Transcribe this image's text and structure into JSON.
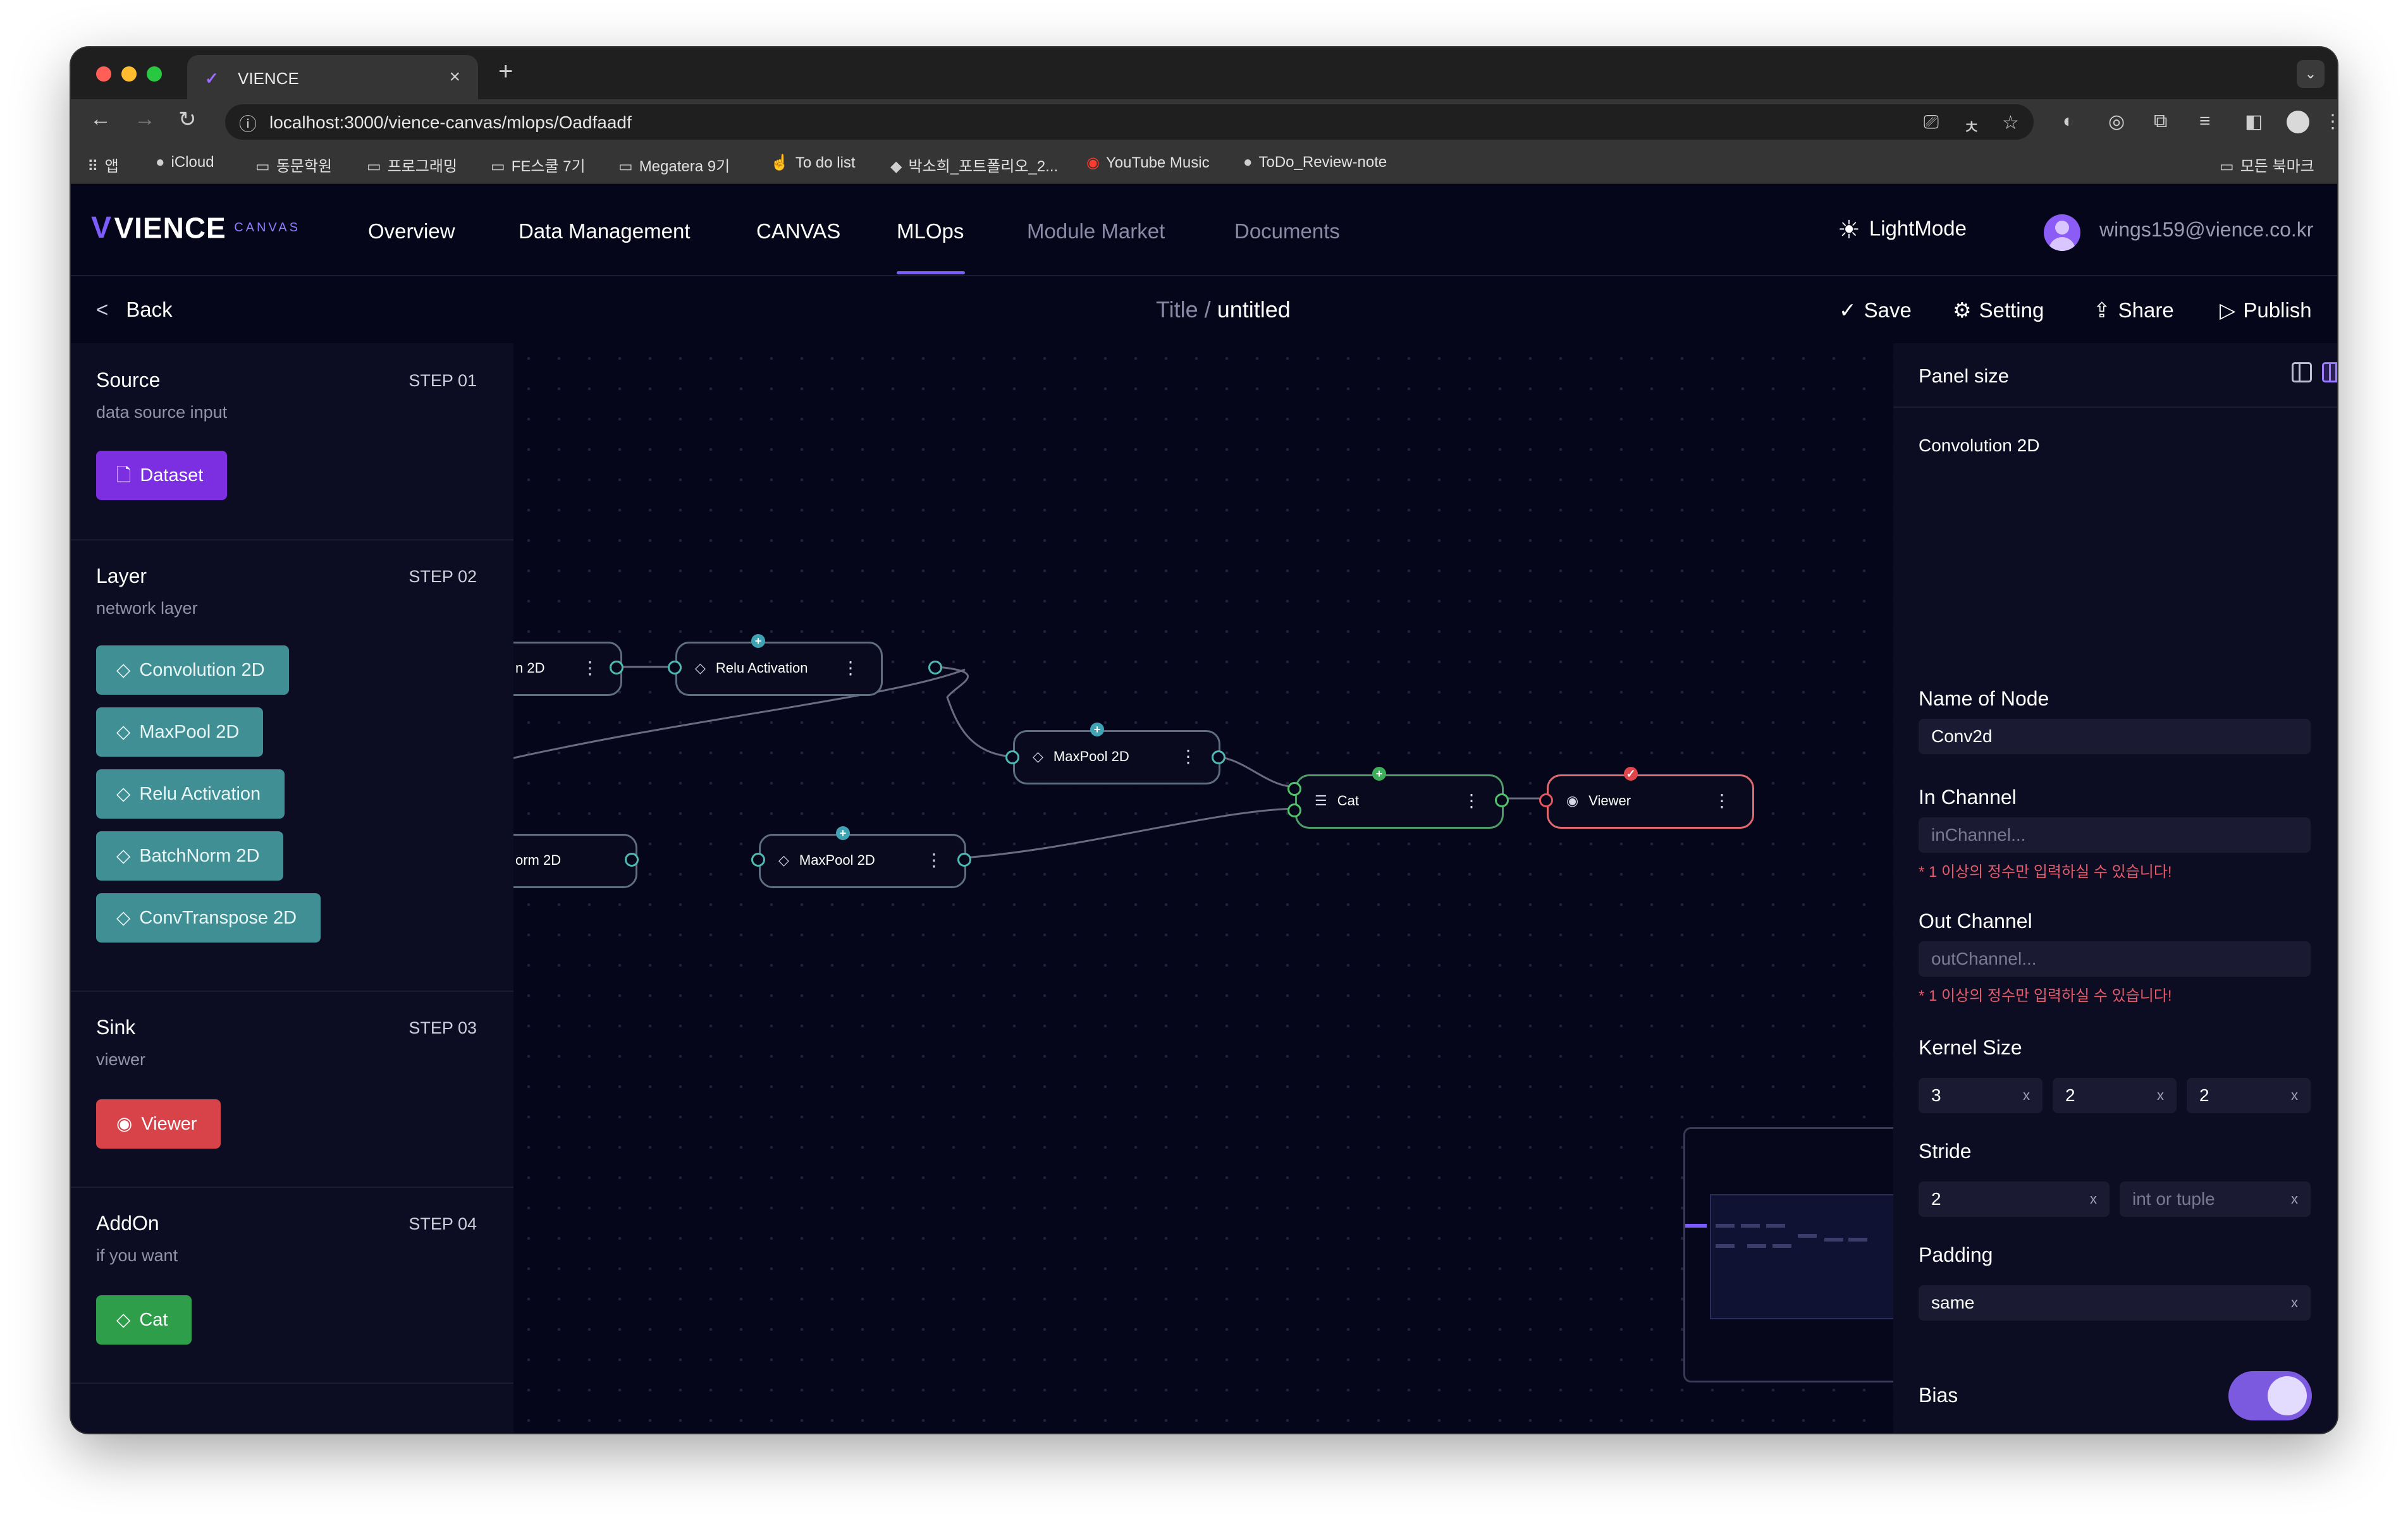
{
  "browser": {
    "tab_title": "VIENCE",
    "url": "localhost:3000/vience-canvas/mlops/Oadfaadf",
    "bookmarks": [
      "앱",
      "iCloud",
      "동문학원",
      "프로그래밍",
      "FE스쿨 7기",
      "Megatera 9기",
      "To do list",
      "박소희_포트폴리오_2...",
      "YouTube Music",
      "ToDo_Review-note"
    ],
    "bookmarks_right": "모든 북마크"
  },
  "header": {
    "logo_name": "VIENCE",
    "logo_sub": "CANVAS",
    "nav": [
      "Overview",
      "Data Management",
      "CANVAS",
      "MLOps",
      "Module Market",
      "Documents"
    ],
    "active_nav": "MLOps",
    "lightmode_label": "LightMode",
    "user_email": "wings159@vience.co.kr"
  },
  "subheader": {
    "back_label": "Back",
    "title_label": "Title /",
    "title_value": "untitled",
    "actions": [
      "Save",
      "Setting",
      "Share",
      "Publish"
    ]
  },
  "left_panel": {
    "sections": [
      {
        "title": "Source",
        "step": "STEP 01",
        "subtitle": "data source input",
        "items": [
          "Dataset"
        ]
      },
      {
        "title": "Layer",
        "step": "STEP 02",
        "subtitle": "network layer",
        "items": [
          "Convolution 2D",
          "MaxPool 2D",
          "Relu Activation",
          "BatchNorm 2D",
          "ConvTranspose 2D"
        ]
      },
      {
        "title": "Sink",
        "step": "STEP 03",
        "subtitle": "viewer",
        "items": [
          "Viewer"
        ]
      },
      {
        "title": "AddOn",
        "step": "STEP 04",
        "subtitle": "if you want",
        "items": [
          "Cat"
        ]
      }
    ]
  },
  "canvas": {
    "nodes": [
      {
        "label": "n 2D"
      },
      {
        "label": "Relu Activation"
      },
      {
        "label": "MaxPool 2D"
      },
      {
        "label": "Cat"
      },
      {
        "label": "Viewer"
      },
      {
        "label": "orm 2D"
      },
      {
        "label": "MaxPool 2D"
      }
    ]
  },
  "right_panel": {
    "title": "Panel size",
    "node_type": "Convolution 2D",
    "name_label": "Name of Node",
    "name_value": "Conv2d",
    "in_channel_label": "In Channel",
    "in_channel_placeholder": "inChannel...",
    "in_channel_hint": "* 1 이상의 정수만 입력하실 수 있습니다!",
    "out_channel_label": "Out Channel",
    "out_channel_placeholder": "outChannel...",
    "out_channel_hint": "* 1 이상의 정수만 입력하실 수 있습니다!",
    "kernel_label": "Kernel Size",
    "kernel_values": [
      "3",
      "2",
      "2"
    ],
    "stride_label": "Stride",
    "stride_value": "2",
    "stride_placeholder": "int or tuple",
    "padding_label": "Padding",
    "padding_value": "same",
    "bias_label": "Bias",
    "bias_on": true,
    "clear_glyph": "x"
  },
  "colors": {
    "accent": "#7b5cff",
    "layer_chip": "#3f8f94",
    "sink_chip": "#d8434a",
    "addon_chip": "#2e9e4a",
    "source_chip": "#7c2fe0",
    "background": "#06061a"
  }
}
